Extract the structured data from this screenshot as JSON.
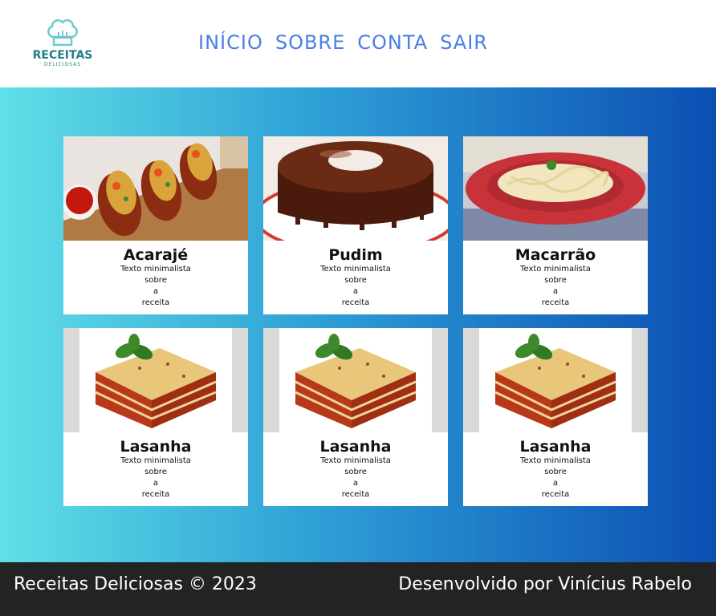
{
  "logo": {
    "title": "RECEITAS",
    "subtitle": "· DELICIOSAS ·"
  },
  "nav": {
    "items": [
      "INÍCIO",
      "SOBRE",
      "CONTA",
      "SAIR"
    ]
  },
  "cards": [
    {
      "title": "Acarajé",
      "lines": [
        "Texto minimalista",
        "sobre",
        "a",
        "receita"
      ],
      "image": "acaraje-photo"
    },
    {
      "title": "Pudim",
      "lines": [
        "Texto minimalista",
        "sobre",
        "a",
        "receita"
      ],
      "image": "pudim-photo"
    },
    {
      "title": "Macarrão",
      "lines": [
        "Texto minimalista",
        "sobre",
        "a",
        "receita"
      ],
      "image": "macarrao-photo"
    },
    {
      "title": "Lasanha",
      "lines": [
        "Texto minimalista",
        "sobre",
        "a",
        "receita"
      ],
      "image": "lasanha-photo"
    },
    {
      "title": "Lasanha",
      "lines": [
        "Texto minimalista",
        "sobre",
        "a",
        "receita"
      ],
      "image": "lasanha-photo"
    },
    {
      "title": "Lasanha",
      "lines": [
        "Texto minimalista",
        "sobre",
        "a",
        "receita"
      ],
      "image": "lasanha-photo"
    }
  ],
  "footer": {
    "left": "Receitas Deliciosas © 2023",
    "right": "Desenvolvido por Vinícius Rabelo"
  },
  "colors": {
    "nav": "#4a7fe4",
    "logo": "#1f7f84",
    "gradient_start": "#5fe0e6",
    "gradient_end": "#0b4fb3",
    "footer_bg": "#232323"
  }
}
